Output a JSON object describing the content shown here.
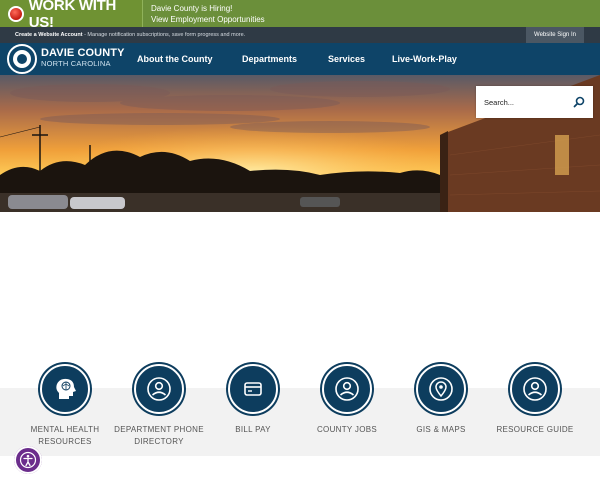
{
  "hiring_banner": {
    "title": "WORK WITH US!",
    "line1": "Davie County is Hiring!",
    "line2": "View Employment Opportunities"
  },
  "account_bar": {
    "link_text": "Create a Website Account",
    "description": " - Manage notification subscriptions, save form progress and more.",
    "sign_in_label": "Website Sign In"
  },
  "header": {
    "brand_name": "DAVIE COUNTY",
    "brand_sub": "NORTH CAROLINA"
  },
  "nav": {
    "items": [
      {
        "label": "About the County"
      },
      {
        "label": "Departments"
      },
      {
        "label": "Services"
      },
      {
        "label": "Live-Work-Play"
      }
    ]
  },
  "search": {
    "placeholder": "Search..."
  },
  "quick_links": {
    "items": [
      {
        "label": "MENTAL HEALTH RESOURCES",
        "icon": "brain-head-icon"
      },
      {
        "label": "DEPARTMENT PHONE DIRECTORY",
        "icon": "person-icon"
      },
      {
        "label": "BILL PAY",
        "icon": "credit-card-icon"
      },
      {
        "label": "COUNTY JOBS",
        "icon": "person-icon"
      },
      {
        "label": "GIS & MAPS",
        "icon": "map-pin-icon"
      },
      {
        "label": "RESOURCE GUIDE",
        "icon": "person-icon"
      }
    ]
  },
  "colors": {
    "hiring_green": "#6b8f3a",
    "nav_blue": "#0e4468",
    "quick_link_blue": "#0d3d5e",
    "accessibility_purple": "#6b2d8c"
  }
}
